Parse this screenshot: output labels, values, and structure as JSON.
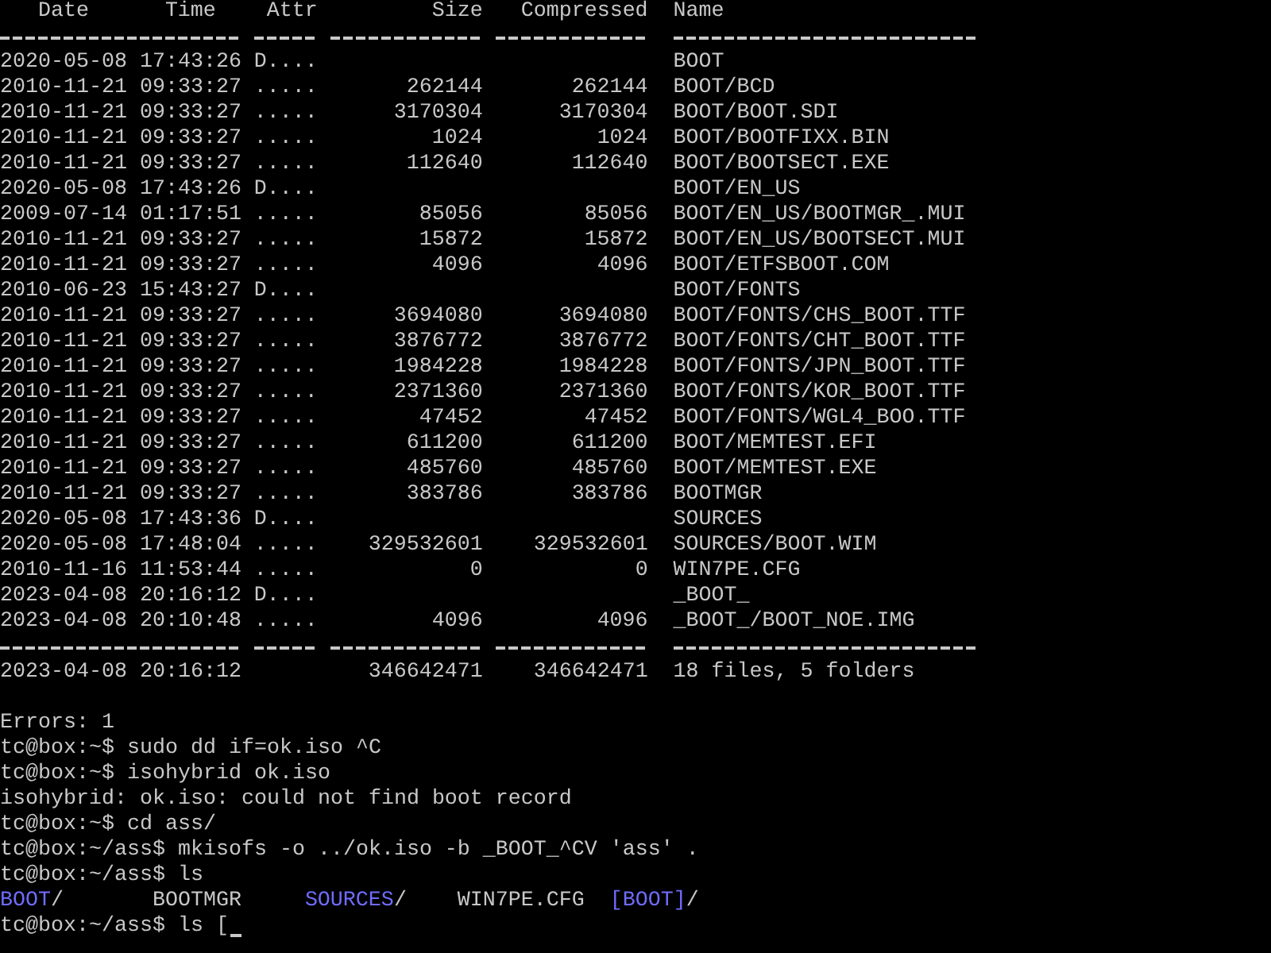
{
  "listing": {
    "columns": [
      "Date",
      "Time",
      "Attr",
      "Size",
      "Compressed",
      "Name"
    ],
    "rows": [
      {
        "date": "2020-05-08",
        "time": "17:43:26",
        "attr": "D....",
        "size": "",
        "compressed": "",
        "name": "BOOT"
      },
      {
        "date": "2010-11-21",
        "time": "09:33:27",
        "attr": ".....",
        "size": "262144",
        "compressed": "262144",
        "name": "BOOT/BCD"
      },
      {
        "date": "2010-11-21",
        "time": "09:33:27",
        "attr": ".....",
        "size": "3170304",
        "compressed": "3170304",
        "name": "BOOT/BOOT.SDI"
      },
      {
        "date": "2010-11-21",
        "time": "09:33:27",
        "attr": ".....",
        "size": "1024",
        "compressed": "1024",
        "name": "BOOT/BOOTFIXX.BIN"
      },
      {
        "date": "2010-11-21",
        "time": "09:33:27",
        "attr": ".....",
        "size": "112640",
        "compressed": "112640",
        "name": "BOOT/BOOTSECT.EXE"
      },
      {
        "date": "2020-05-08",
        "time": "17:43:26",
        "attr": "D....",
        "size": "",
        "compressed": "",
        "name": "BOOT/EN_US"
      },
      {
        "date": "2009-07-14",
        "time": "01:17:51",
        "attr": ".....",
        "size": "85056",
        "compressed": "85056",
        "name": "BOOT/EN_US/BOOTMGR_.MUI"
      },
      {
        "date": "2010-11-21",
        "time": "09:33:27",
        "attr": ".....",
        "size": "15872",
        "compressed": "15872",
        "name": "BOOT/EN_US/BOOTSECT.MUI"
      },
      {
        "date": "2010-11-21",
        "time": "09:33:27",
        "attr": ".....",
        "size": "4096",
        "compressed": "4096",
        "name": "BOOT/ETFSBOOT.COM"
      },
      {
        "date": "2010-06-23",
        "time": "15:43:27",
        "attr": "D....",
        "size": "",
        "compressed": "",
        "name": "BOOT/FONTS"
      },
      {
        "date": "2010-11-21",
        "time": "09:33:27",
        "attr": ".....",
        "size": "3694080",
        "compressed": "3694080",
        "name": "BOOT/FONTS/CHS_BOOT.TTF"
      },
      {
        "date": "2010-11-21",
        "time": "09:33:27",
        "attr": ".....",
        "size": "3876772",
        "compressed": "3876772",
        "name": "BOOT/FONTS/CHT_BOOT.TTF"
      },
      {
        "date": "2010-11-21",
        "time": "09:33:27",
        "attr": ".....",
        "size": "1984228",
        "compressed": "1984228",
        "name": "BOOT/FONTS/JPN_BOOT.TTF"
      },
      {
        "date": "2010-11-21",
        "time": "09:33:27",
        "attr": ".....",
        "size": "2371360",
        "compressed": "2371360",
        "name": "BOOT/FONTS/KOR_BOOT.TTF"
      },
      {
        "date": "2010-11-21",
        "time": "09:33:27",
        "attr": ".....",
        "size": "47452",
        "compressed": "47452",
        "name": "BOOT/FONTS/WGL4_BOO.TTF"
      },
      {
        "date": "2010-11-21",
        "time": "09:33:27",
        "attr": ".....",
        "size": "611200",
        "compressed": "611200",
        "name": "BOOT/MEMTEST.EFI"
      },
      {
        "date": "2010-11-21",
        "time": "09:33:27",
        "attr": ".....",
        "size": "485760",
        "compressed": "485760",
        "name": "BOOT/MEMTEST.EXE"
      },
      {
        "date": "2010-11-21",
        "time": "09:33:27",
        "attr": ".....",
        "size": "383786",
        "compressed": "383786",
        "name": "BOOTMGR"
      },
      {
        "date": "2020-05-08",
        "time": "17:43:36",
        "attr": "D....",
        "size": "",
        "compressed": "",
        "name": "SOURCES"
      },
      {
        "date": "2020-05-08",
        "time": "17:48:04",
        "attr": ".....",
        "size": "329532601",
        "compressed": "329532601",
        "name": "SOURCES/BOOT.WIM"
      },
      {
        "date": "2010-11-16",
        "time": "11:53:44",
        "attr": ".....",
        "size": "0",
        "compressed": "0",
        "name": "WIN7PE.CFG"
      },
      {
        "date": "2023-04-08",
        "time": "20:16:12",
        "attr": "D....",
        "size": "",
        "compressed": "",
        "name": "_BOOT_"
      },
      {
        "date": "2023-04-08",
        "time": "20:10:48",
        "attr": ".....",
        "size": "4096",
        "compressed": "4096",
        "name": "_BOOT_/BOOT_NOE.IMG"
      }
    ],
    "summary": {
      "date": "2023-04-08",
      "time": "20:16:12",
      "size": "346642471",
      "compressed": "346642471",
      "name": "18 files, 5 folders"
    }
  },
  "output_lines": [
    "Errors: 1",
    "tc@box:~$ sudo dd if=ok.iso ^C",
    "tc@box:~$ isohybrid ok.iso",
    "isohybrid: ok.iso: could not find boot record",
    "tc@box:~$ cd ass/",
    "tc@box:~/ass$ mkisofs -o ../ok.iso -b _BOOT_^CV 'ass' .",
    "tc@box:~/ass$ ls"
  ],
  "ls_entries": [
    {
      "kind": "dir",
      "name": "BOOT",
      "suffix": "/"
    },
    {
      "kind": "file",
      "name": "BOOTMGR"
    },
    {
      "kind": "dir",
      "name": "SOURCES",
      "suffix": "/"
    },
    {
      "kind": "file",
      "name": "WIN7PE.CFG"
    },
    {
      "kind": "dir",
      "name": "[BOOT]",
      "suffix": "/"
    }
  ],
  "input_line": {
    "text": "tc@box:~/ass$ ls [",
    "cursor": true
  }
}
